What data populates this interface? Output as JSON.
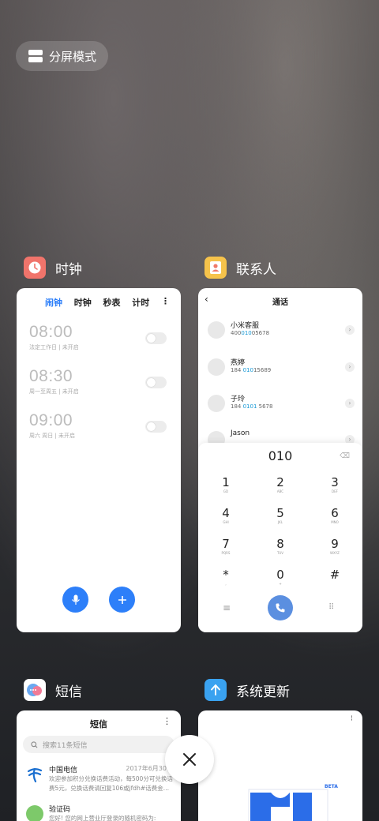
{
  "split_screen_label": "分屏模式",
  "clock": {
    "app_name": "时钟",
    "tabs": [
      "闹钟",
      "时钟",
      "秒表",
      "计时"
    ],
    "alarms": [
      {
        "time": "08:00",
        "sub": "法定工作日 | 未开启"
      },
      {
        "time": "08:30",
        "sub": "周一至周五 | 未开启"
      },
      {
        "time": "09:00",
        "sub": "周六 周日 | 未开启"
      }
    ]
  },
  "contacts": {
    "app_name": "联系人",
    "title": "通话",
    "list": [
      {
        "name": "小米客服",
        "phone_pre": "400",
        "phone_hl": "010",
        "phone_post": "05678"
      },
      {
        "name": "燕婷",
        "phone_pre": "184 ",
        "phone_hl": "010",
        "phone_post": "15689"
      },
      {
        "name": "子玲",
        "phone_pre": "184 ",
        "phone_hl": "0101",
        "phone_post": " 5678"
      },
      {
        "name": "Jason",
        "phone_pre": "",
        "phone_hl": "",
        "phone_post": ""
      }
    ],
    "dial_input": "010",
    "keys": [
      {
        "d": "1",
        "l": "GD"
      },
      {
        "d": "2",
        "l": "ABC"
      },
      {
        "d": "3",
        "l": "DEF"
      },
      {
        "d": "4",
        "l": "GHI"
      },
      {
        "d": "5",
        "l": "JKL"
      },
      {
        "d": "6",
        "l": "MNO"
      },
      {
        "d": "7",
        "l": "PQRS"
      },
      {
        "d": "8",
        "l": "TUV"
      },
      {
        "d": "9",
        "l": "WXYZ"
      },
      {
        "d": "*",
        "l": ","
      },
      {
        "d": "0",
        "l": "+"
      },
      {
        "d": "#",
        "l": ""
      }
    ]
  },
  "sms": {
    "app_name": "短信",
    "title": "短信",
    "search_placeholder": "搜索11条短信",
    "messages": [
      {
        "from": "中国电信",
        "date": "2017年6月30日",
        "body": "欢迎参加积分兑换话费活动，每500分可兑换话费5元，兑换话费请回复106或jfdh#话费金…"
      },
      {
        "from": "验证码",
        "date": "",
        "body": "您好! 您的网上营业厅登录的随机密码为:"
      }
    ]
  },
  "update": {
    "app_name": "系统更新",
    "badge": "BETA"
  },
  "colors": {
    "accent": "#2d7ff9",
    "highlight": "#1a9ad6"
  }
}
